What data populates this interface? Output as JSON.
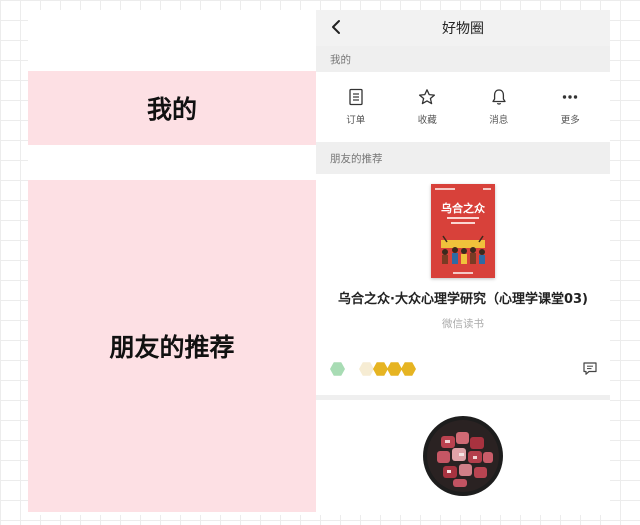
{
  "annotations": {
    "mine": "我的",
    "recommend": "朋友的推荐"
  },
  "navbar": {
    "back_icon": "chevron-left-icon",
    "title": "好物圈"
  },
  "mine_section": {
    "header": "我的",
    "items": [
      {
        "label": "订单",
        "icon": "document-icon"
      },
      {
        "label": "收藏",
        "icon": "star-icon"
      },
      {
        "label": "消息",
        "icon": "bell-icon"
      },
      {
        "label": "更多",
        "icon": "more-icon"
      }
    ]
  },
  "recommend_section": {
    "header": "朋友的推荐",
    "card": {
      "cover_title": "乌合之众",
      "title": "乌合之众·大众心理学研究（心理学课堂03)",
      "source": "微信读书",
      "comment_icon": "comment-icon"
    }
  },
  "colors": {
    "annotation_bg": "#fde0e4",
    "section_bg": "#efefef",
    "book_red": "#d8413a",
    "avatar_green": "#a8dcb4",
    "avatar_cream": "#f6ecd3",
    "avatar_gold": "#e6b422"
  }
}
